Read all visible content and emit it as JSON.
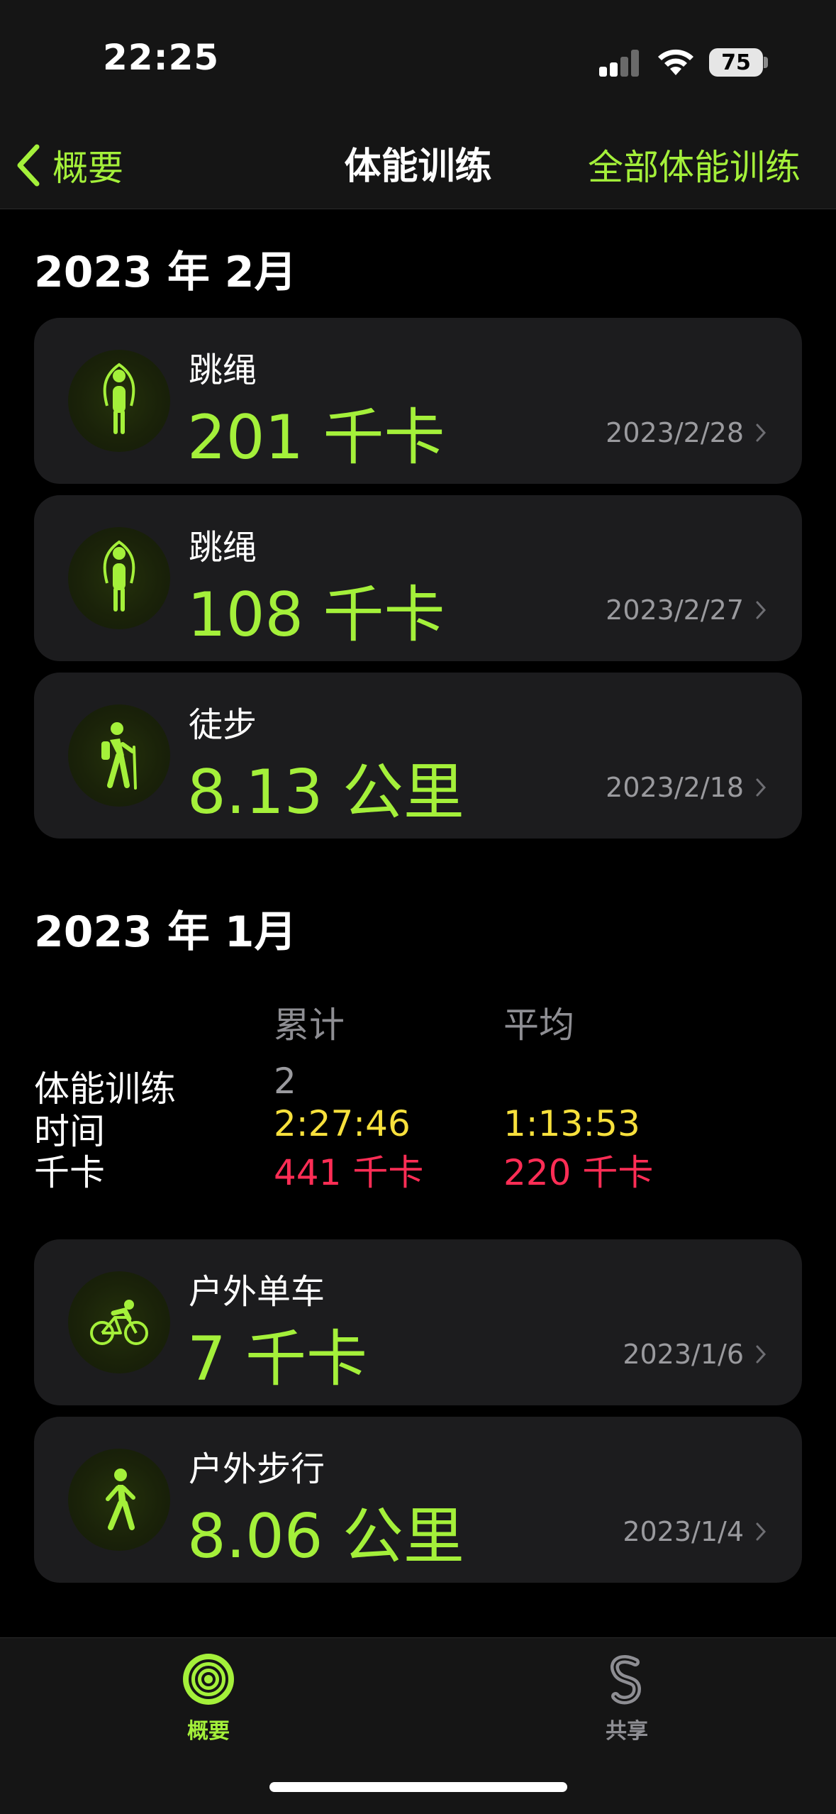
{
  "status": {
    "time": "22:25",
    "battery": "75"
  },
  "nav": {
    "back_label": "概要",
    "title": "体能训练",
    "right_label": "全部体能训练"
  },
  "sections": [
    {
      "title": "2023 年 2月",
      "workouts": [
        {
          "name": "跳绳",
          "value": "201 千卡",
          "date": "2023/2/28",
          "icon": "jump-rope-icon"
        },
        {
          "name": "跳绳",
          "value": "108 千卡",
          "date": "2023/2/27",
          "icon": "jump-rope-icon"
        },
        {
          "name": "徒步",
          "value": "8.13 公里",
          "date": "2023/2/18",
          "icon": "hiking-icon"
        }
      ]
    },
    {
      "title": "2023 年 1月",
      "summary": {
        "col_total": "累计",
        "col_avg": "平均",
        "rows": [
          {
            "label": "体能训练",
            "total": "2",
            "avg": ""
          },
          {
            "label": "时间",
            "total": "2:27:46",
            "avg": "1:13:53"
          },
          {
            "label": "千卡",
            "total": "441 千卡",
            "avg": "220 千卡"
          }
        ]
      },
      "workouts": [
        {
          "name": "户外单车",
          "value": "7 千卡",
          "date": "2023/1/6",
          "icon": "cycling-icon"
        },
        {
          "name": "户外步行",
          "value": "8.06 公里",
          "date": "2023/1/4",
          "icon": "walking-icon"
        }
      ]
    }
  ],
  "tabs": [
    {
      "label": "概要",
      "icon": "activity-rings-icon",
      "active": true
    },
    {
      "label": "共享",
      "icon": "sharing-icon",
      "active": false
    }
  ],
  "colors": {
    "accent": "#a4f03a",
    "time_color": "#f7e03c",
    "calorie_color": "#ff2d55",
    "card_bg": "#1c1c1e"
  }
}
